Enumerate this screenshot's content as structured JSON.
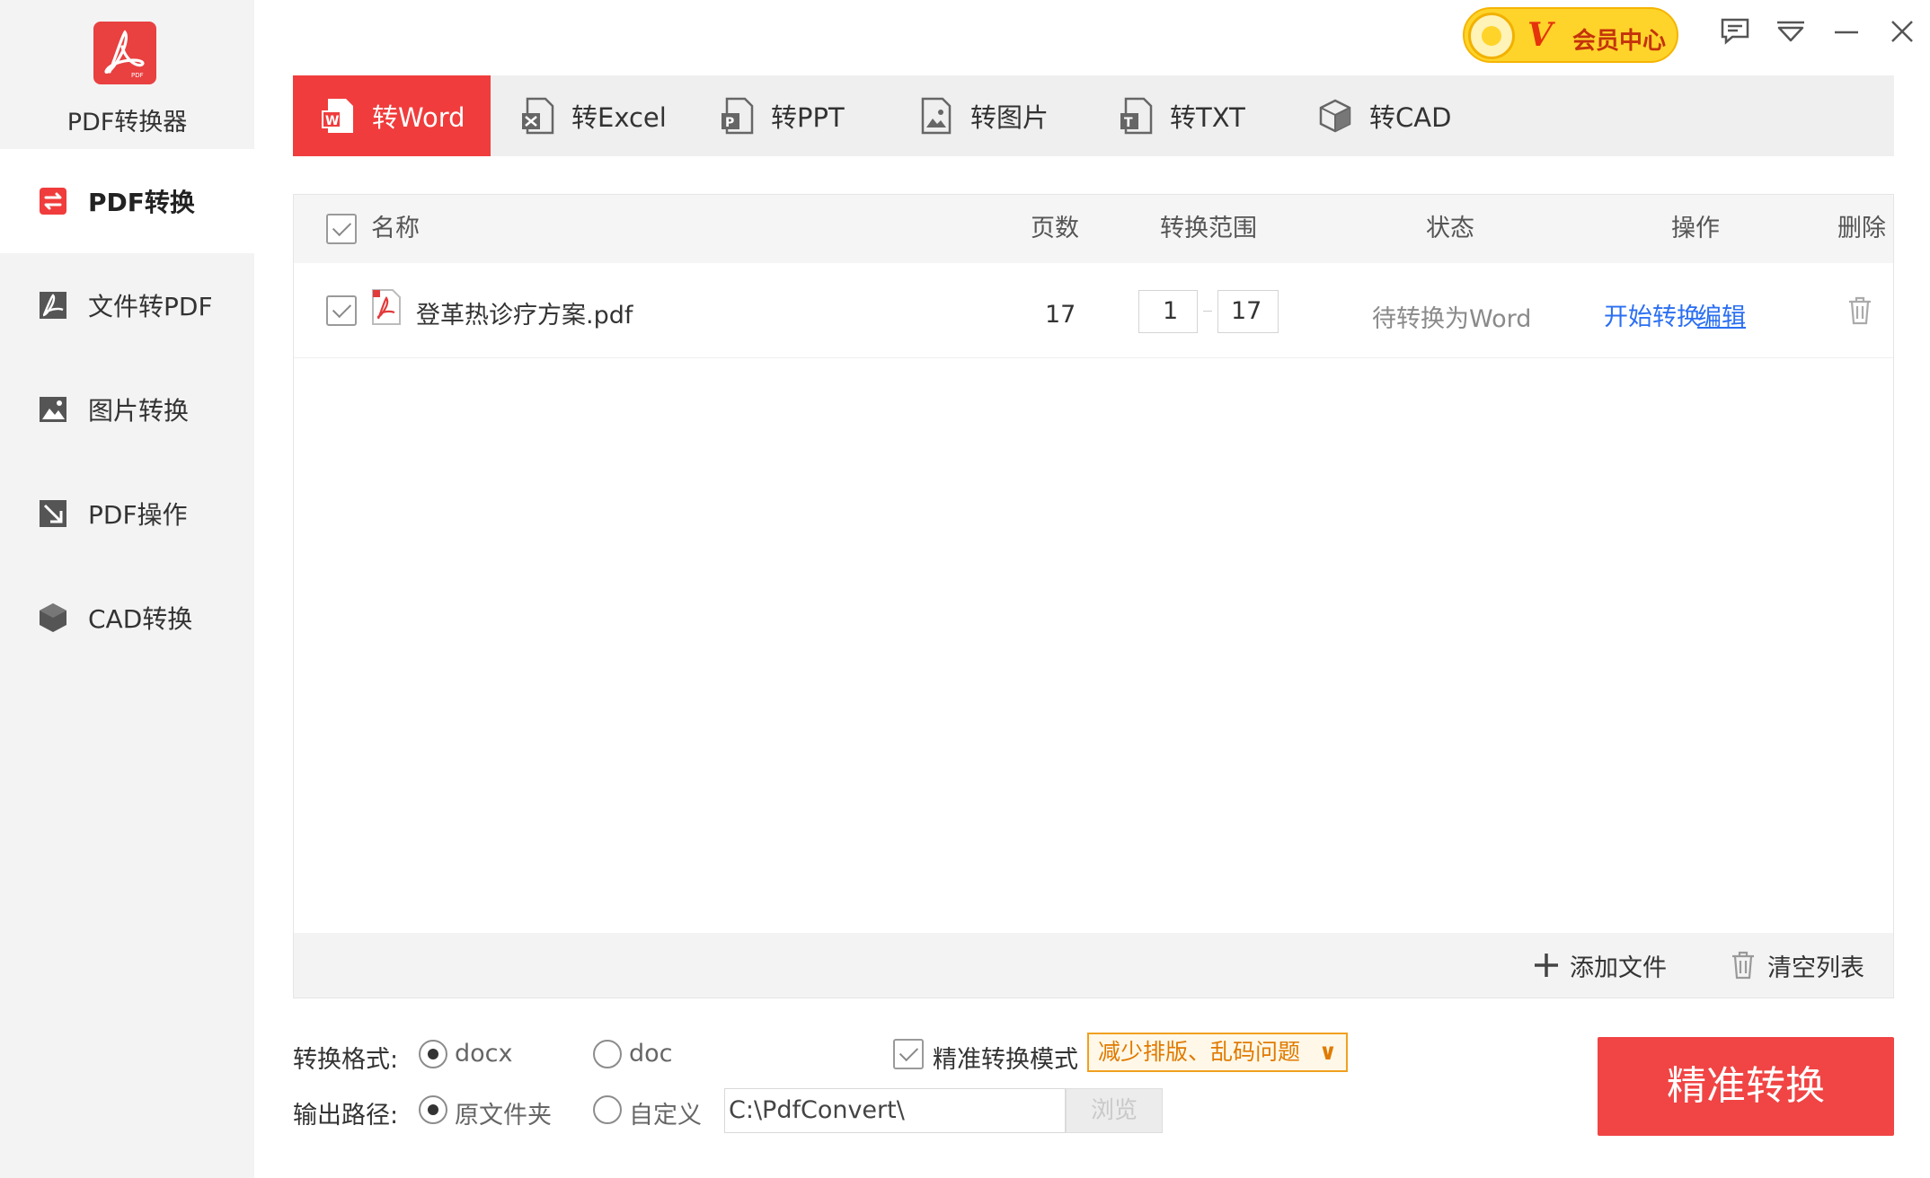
{
  "app": {
    "name": "PDF转换器"
  },
  "sidebar": {
    "items": [
      {
        "label": "PDF转换",
        "icon": "convert-arrows-icon",
        "active": true
      },
      {
        "label": "文件转PDF",
        "icon": "pdf-acrobat-icon",
        "active": false
      },
      {
        "label": "图片转换",
        "icon": "image-icon",
        "active": false
      },
      {
        "label": "PDF操作",
        "icon": "pdf-edit-icon",
        "active": false
      },
      {
        "label": "CAD转换",
        "icon": "cube-icon",
        "active": false
      }
    ]
  },
  "header": {
    "vip_mark": "V",
    "vip_label": "会员中心"
  },
  "tabs": [
    {
      "label": "转Word",
      "icon": "word-file-icon",
      "active": true
    },
    {
      "label": "转Excel",
      "icon": "excel-file-icon",
      "active": false
    },
    {
      "label": "转PPT",
      "icon": "ppt-file-icon",
      "active": false
    },
    {
      "label": "转图片",
      "icon": "image-file-icon",
      "active": false
    },
    {
      "label": "转TXT",
      "icon": "txt-file-icon",
      "active": false
    },
    {
      "label": "转CAD",
      "icon": "cad-cube-icon",
      "active": false
    }
  ],
  "table": {
    "columns": {
      "name": "名称",
      "pages": "页数",
      "range": "转换范围",
      "status": "状态",
      "actions": "操作",
      "delete": "删除"
    },
    "rows": [
      {
        "checked": true,
        "filename": "登革热诊疗方案.pdf",
        "pages": "17",
        "range_from": "1",
        "range_to": "17",
        "status": "待转换为Word",
        "start_action": "开始转换",
        "edit_action": "编辑"
      }
    ],
    "footer": {
      "add_label": "添加文件",
      "clear_label": "清空列表"
    }
  },
  "options": {
    "format_label": "转换格式:",
    "format_options": [
      "docx",
      "doc"
    ],
    "format_selected": "docx",
    "precise_mode_label": "精准转换模式",
    "precise_mode_checked": true,
    "precise_hint": "减少排版、乱码问题",
    "output_label": "输出路径:",
    "output_options": [
      "原文件夹",
      "自定义"
    ],
    "output_selected": "原文件夹",
    "output_path": "C:\\PdfConvert\\",
    "browse_label": "浏览",
    "convert_button": "精准转换"
  },
  "colors": {
    "accent": "#f03c3c",
    "link": "#2b6ff2",
    "vip": "#ffd42a"
  }
}
